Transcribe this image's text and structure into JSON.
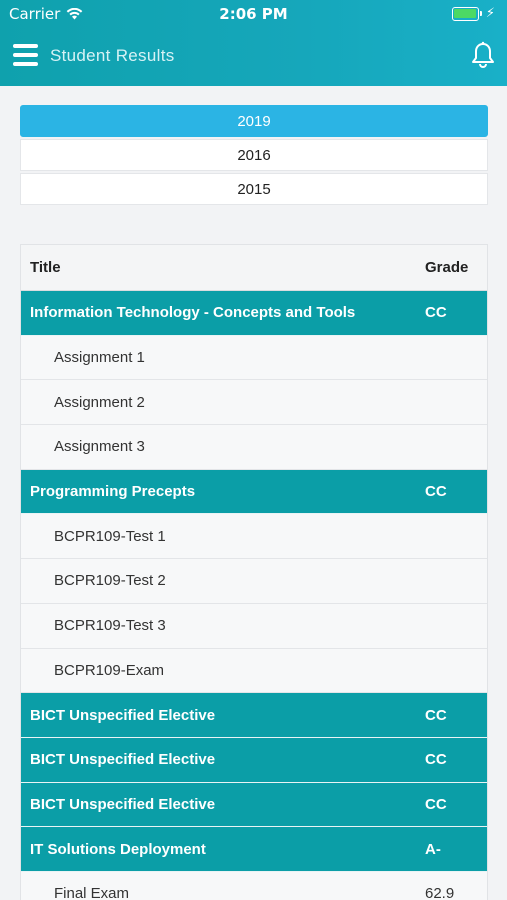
{
  "status_bar": {
    "carrier": "Carrier",
    "time": "2:06 PM"
  },
  "app_bar": {
    "title": "Student Results"
  },
  "years": [
    "2019",
    "2016",
    "2015"
  ],
  "selected_year": "2019",
  "table": {
    "headers": {
      "title": "Title",
      "grade": "Grade"
    },
    "rows": [
      {
        "type": "course",
        "title": "Information Technology - Concepts and Tools",
        "grade": "CC"
      },
      {
        "type": "item",
        "title": "Assignment 1",
        "grade": ""
      },
      {
        "type": "item",
        "title": "Assignment 2",
        "grade": ""
      },
      {
        "type": "item",
        "title": "Assignment 3",
        "grade": ""
      },
      {
        "type": "course",
        "title": "Programming Precepts",
        "grade": "CC"
      },
      {
        "type": "item",
        "title": "BCPR109-Test 1",
        "grade": ""
      },
      {
        "type": "item",
        "title": "BCPR109-Test 2",
        "grade": ""
      },
      {
        "type": "item",
        "title": "BCPR109-Test 3",
        "grade": ""
      },
      {
        "type": "item",
        "title": "BCPR109-Exam",
        "grade": ""
      },
      {
        "type": "course",
        "title": "BICT Unspecified Elective",
        "grade": "CC"
      },
      {
        "type": "course",
        "title": "BICT Unspecified Elective",
        "grade": "CC"
      },
      {
        "type": "course",
        "title": "BICT Unspecified Elective",
        "grade": "CC"
      },
      {
        "type": "course",
        "title": "IT Solutions Deployment",
        "grade": "A-"
      },
      {
        "type": "item",
        "title": "Final Exam",
        "grade": "62.9"
      }
    ]
  },
  "colors": {
    "header_teal": "#16a7bb",
    "course_row": "#0b9ea7",
    "year_active": "#2bb4e4",
    "battery_green": "#4cd964"
  }
}
